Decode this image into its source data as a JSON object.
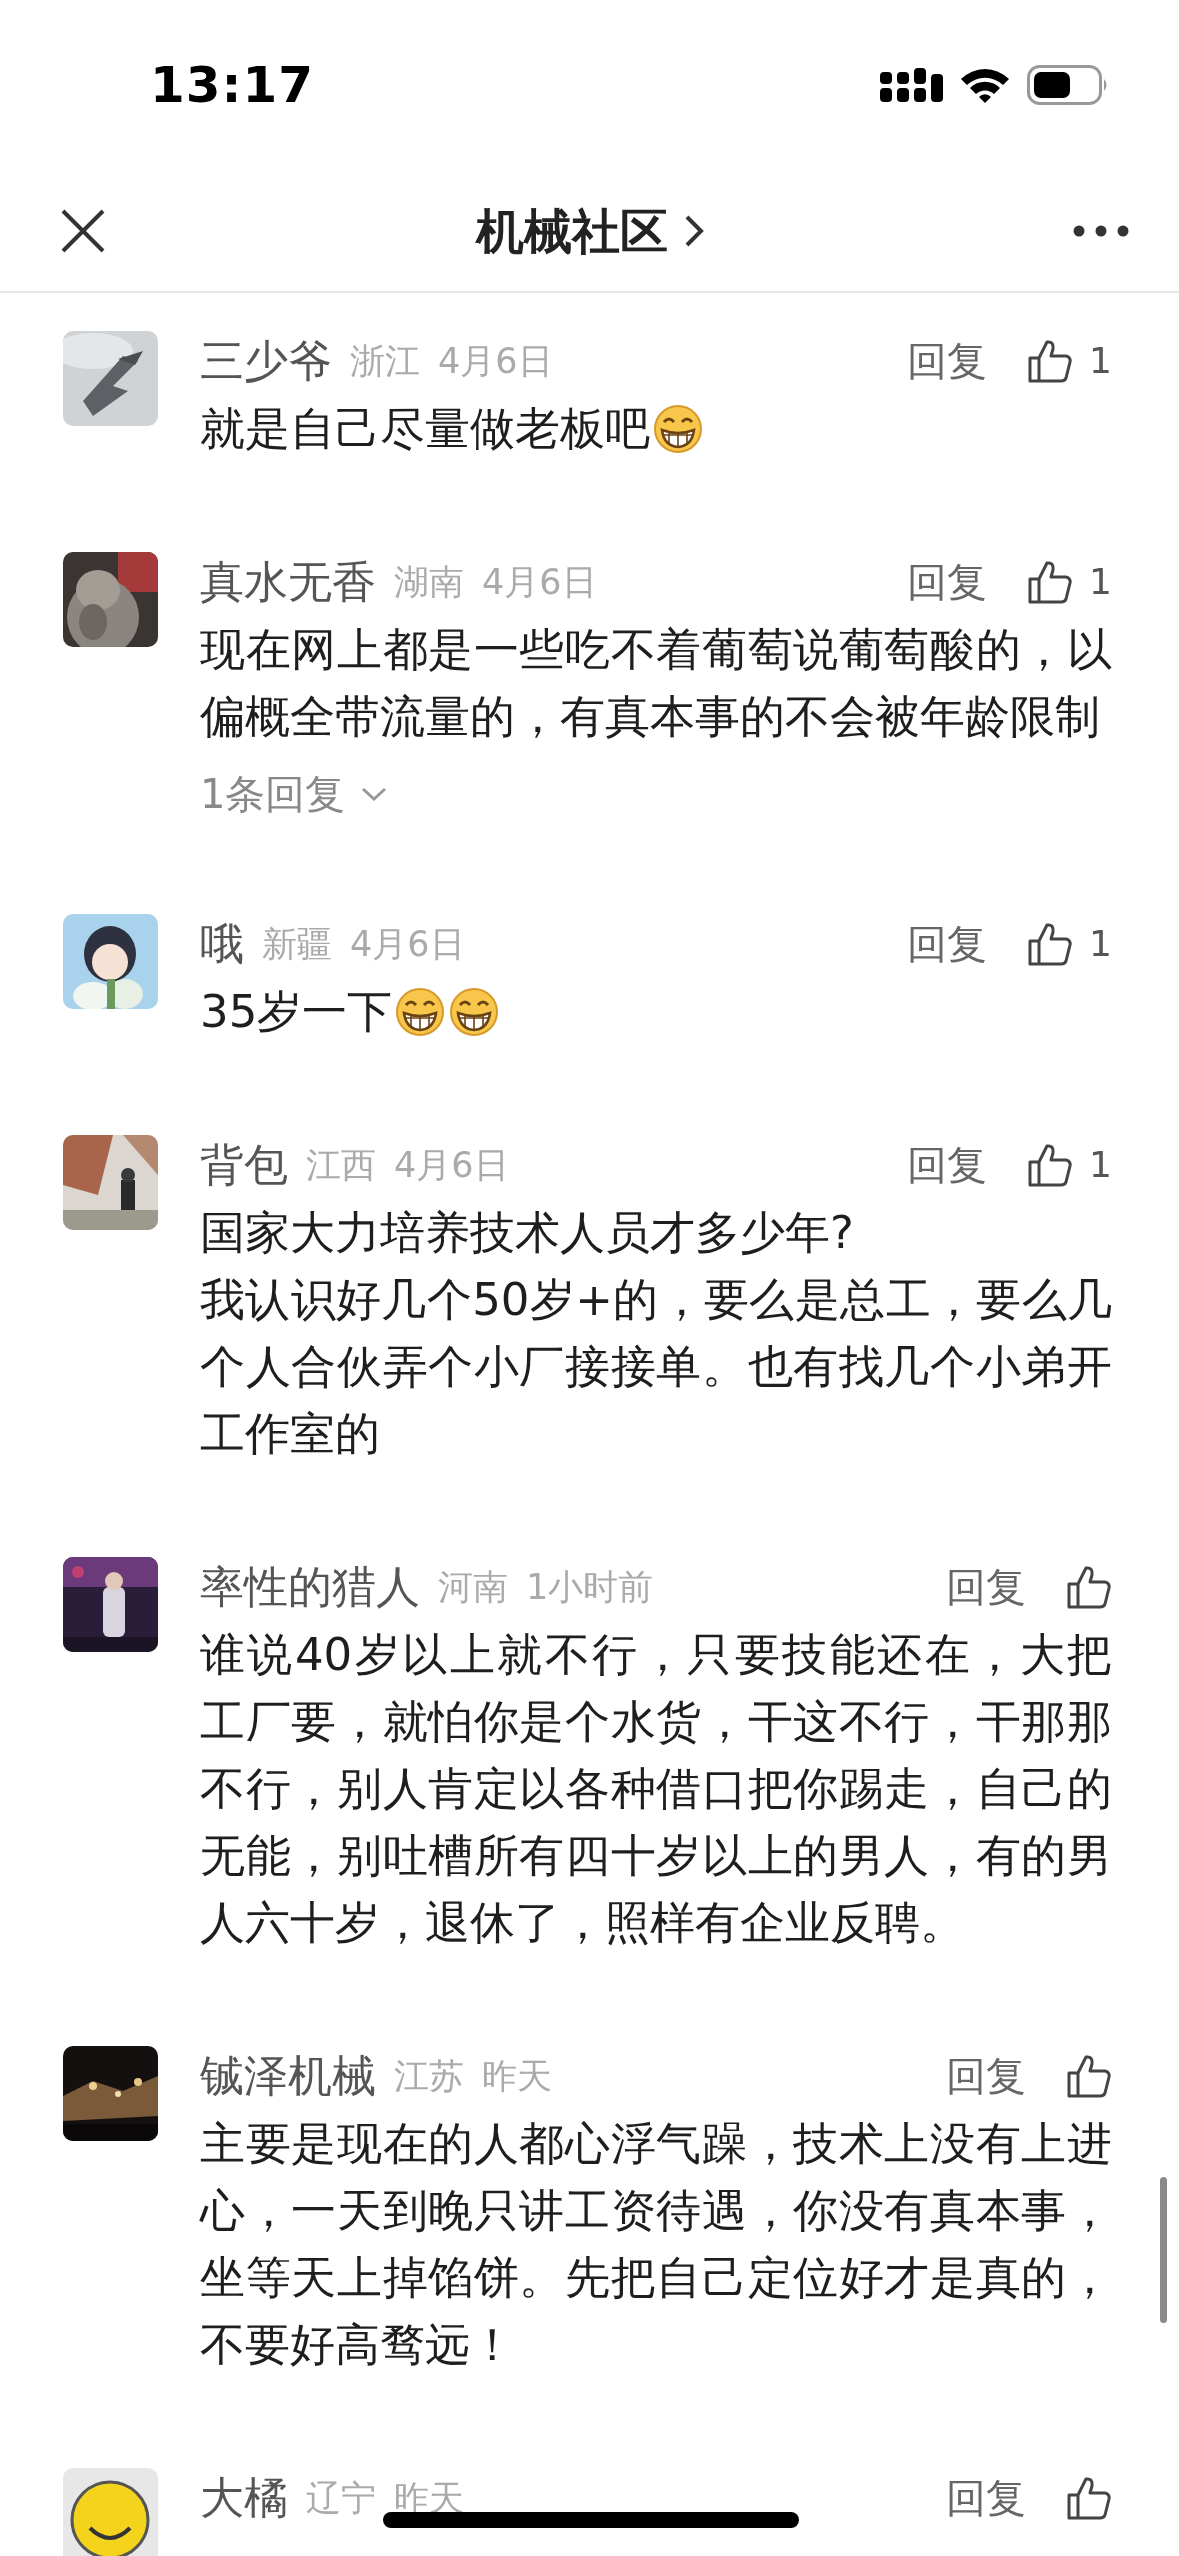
{
  "status_bar": {
    "time": "13:17"
  },
  "nav": {
    "title": "机械社区"
  },
  "comments": [
    {
      "name": "三少爷",
      "region": "浙江",
      "date": "4月6日",
      "reply": "回复",
      "likes": "1",
      "body": [
        {
          "kind": "text",
          "text": "就是自己尽量做老板吧"
        },
        {
          "kind": "emoji"
        }
      ]
    },
    {
      "name": "真水无香",
      "region": "湖南",
      "date": "4月6日",
      "reply": "回复",
      "likes": "1",
      "body": [
        {
          "kind": "text",
          "text": "现在网上都是一些吃不着葡萄说葡萄酸的，以偏概全带流量的，有真本事的不会被年龄限制"
        }
      ],
      "replies_link": "1条回复"
    },
    {
      "name": "哦",
      "region": "新疆",
      "date": "4月6日",
      "reply": "回复",
      "likes": "1",
      "body": [
        {
          "kind": "text",
          "text": "35岁一下"
        },
        {
          "kind": "emoji"
        },
        {
          "kind": "emoji"
        }
      ]
    },
    {
      "name": "背包",
      "region": "江西",
      "date": "4月6日",
      "reply": "回复",
      "likes": "1",
      "body": [
        {
          "kind": "text",
          "text": "国家大力培养技术人员才多少年?\n我认识好几个50岁+的，要么是总工，要么几个人合伙弄个小厂接接单。也有找几个小弟开工作室的"
        }
      ]
    },
    {
      "name": "率性的猎人",
      "region": "河南",
      "date": "1小时前",
      "reply": "回复",
      "body": [
        {
          "kind": "text",
          "text": "谁说40岁以上就不行，只要技能还在，大把工厂要，就怕你是个水货，干这不行，干那那不行，别人肯定以各种借口把你踢走，自己的无能，别吐槽所有四十岁以上的男人，有的男人六十岁，退休了，照样有企业反聘。"
        }
      ]
    },
    {
      "name": "铖泽机械",
      "region": "江苏",
      "date": "昨天",
      "reply": "回复",
      "body": [
        {
          "kind": "text",
          "text": "主要是现在的人都心浮气躁，技术上没有上进心，一天到晚只讲工资待遇，你没有真本事，坐等天上掉馅饼。先把自己定位好才是真的，不要好高骛远！"
        }
      ]
    },
    {
      "name": "大橘",
      "region": "辽宁",
      "date": "昨天",
      "reply": "回复"
    }
  ]
}
